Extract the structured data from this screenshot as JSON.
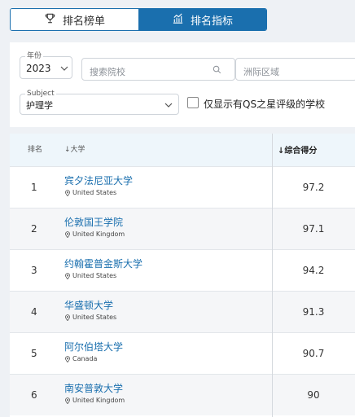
{
  "tabs": [
    {
      "label": "排名榜单",
      "icon": "trophy-icon",
      "active": false
    },
    {
      "label": "排名指标",
      "icon": "bar-chart-icon",
      "active": true
    }
  ],
  "filters": {
    "year": {
      "legend": "年份",
      "value": "2023"
    },
    "search": {
      "placeholder": "搜索院校"
    },
    "region": {
      "placeholder": "洲际区域"
    },
    "subject": {
      "legend": "Subject",
      "value": "护理学"
    },
    "qs_stars_checkbox": {
      "label": "仅显示有QS之星评级的学校",
      "checked": false
    }
  },
  "table": {
    "headers": {
      "rank": "排名",
      "university": "↓大学",
      "score": "↓综合得分"
    },
    "rows": [
      {
        "rank": "1",
        "name": "宾夕法尼亚大学",
        "country": "United States",
        "score": "97.2"
      },
      {
        "rank": "2",
        "name": "伦敦国王学院",
        "country": "United Kingdom",
        "score": "97.1"
      },
      {
        "rank": "3",
        "name": "约翰霍普金斯大学",
        "country": "United States",
        "score": "94.2"
      },
      {
        "rank": "4",
        "name": "华盛顿大学",
        "country": "United States",
        "score": "91.3"
      },
      {
        "rank": "5",
        "name": "阿尔伯塔大学",
        "country": "Canada",
        "score": "90.7"
      },
      {
        "rank": "6",
        "name": "南安普敦大学",
        "country": "United Kingdom",
        "score": "90"
      }
    ]
  },
  "colors": {
    "accent": "#1a6fae",
    "header_bg": "#eef6fb",
    "page_bg": "#eef1f5"
  }
}
